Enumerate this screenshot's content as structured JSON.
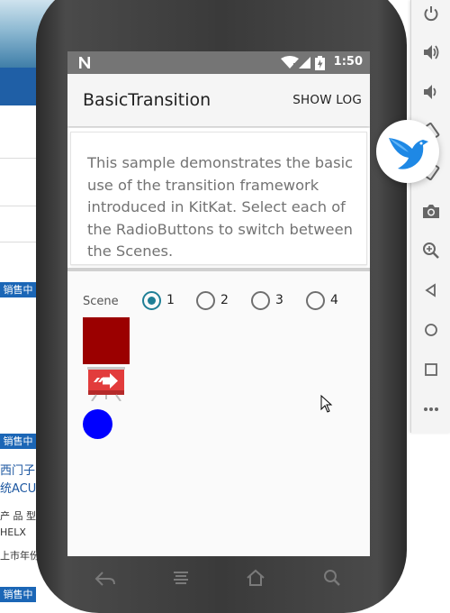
{
  "background_page": {
    "badges": [
      "销售中",
      "销售中",
      "销售中"
    ],
    "texts": [
      "西门子",
      "统ACU",
      "产 品 型",
      "HELX",
      "上市年份"
    ]
  },
  "status_bar": {
    "time": "1:50"
  },
  "app": {
    "title": "BasicTransition",
    "action": "SHOW LOG",
    "description": "This sample demonstrates the basic use of the transition framework introduced in KitKat. Select each of the RadioButtons to switch between the Scenes.",
    "scene_label": "Scene",
    "scenes": [
      {
        "label": "1",
        "checked": true
      },
      {
        "label": "2",
        "checked": false
      },
      {
        "label": "3",
        "checked": false
      },
      {
        "label": "4",
        "checked": false
      }
    ]
  },
  "colors": {
    "accent": "#1f7f96",
    "square": "#9b0000",
    "circle": "#0000ff",
    "status_bar": "#757575"
  },
  "emulator_controls": [
    "power-icon",
    "volume-up-icon",
    "volume-down-icon",
    "rotate-left-icon",
    "rotate-right-icon",
    "camera-icon",
    "zoom-icon",
    "back-icon",
    "home-icon",
    "overview-icon",
    "more-icon"
  ],
  "nav_icons": [
    "back-icon",
    "recent-apps-icon",
    "home-icon",
    "search-icon"
  ]
}
